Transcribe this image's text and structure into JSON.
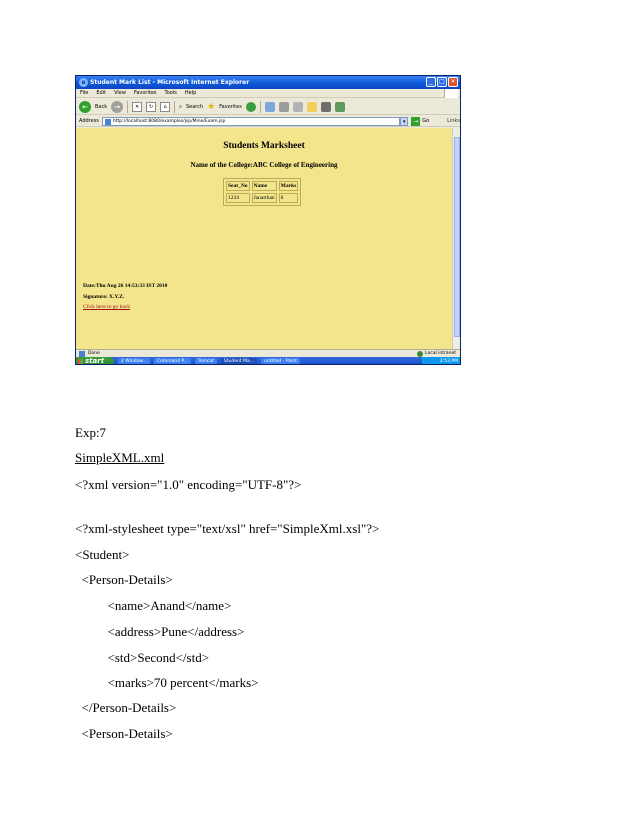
{
  "browser": {
    "window_title": "Student Mark List - Microsoft Internet Explorer",
    "menu": [
      "File",
      "Edit",
      "View",
      "Favorites",
      "Tools",
      "Help"
    ],
    "toolbar": {
      "back_label": "Back",
      "search_label": "Search",
      "favorites_label": "Favorites"
    },
    "address": {
      "label": "Address",
      "url": "http://localhost:8080/examples/jsp/Mine/Exam.jsp",
      "go_label": "Go",
      "links_label": "Links"
    },
    "status": {
      "left": "Done",
      "zone": "Local intranet"
    },
    "taskbar": {
      "start_label": "start",
      "tasks": [
        "2 Window...",
        "Command P...",
        "Tomcat",
        "Student Ma...",
        "untitled - Paint"
      ],
      "clock": "2:53 PM"
    },
    "page": {
      "heading": "Students Marksheet",
      "college": "Name of the College:ABC College of Engineering",
      "table": {
        "headers": [
          "Seat_No",
          "Name",
          "Marks"
        ],
        "row": [
          "1234",
          "Janarthan",
          "6"
        ]
      },
      "date": "Date:Thu Aug 26 14:53:33 IST 2010",
      "signature": "Signature:  X.Y.Z.",
      "back_link": "Click here to go back"
    },
    "colors": {
      "page_bg": "#F2E58C",
      "titlebar": "#0B58D8",
      "link": "#A0131B"
    }
  },
  "document": {
    "exp_label": "Exp:7",
    "filename": "SimpleXML.xml",
    "lines": [
      "<?xml version=\"1.0\" encoding=\"UTF-8\"?>",
      "<?xml-stylesheet type=\"text/xsl\" href=\"SimpleXml.xsl\"?>",
      "<Student>",
      "  <Person-Details>",
      "          <name>Anand</name>",
      "          <address>Pune</address>",
      "          <std>Second</std>",
      "          <marks>70 percent</marks>",
      "  </Person-Details>",
      "  <Person-Details>"
    ]
  }
}
